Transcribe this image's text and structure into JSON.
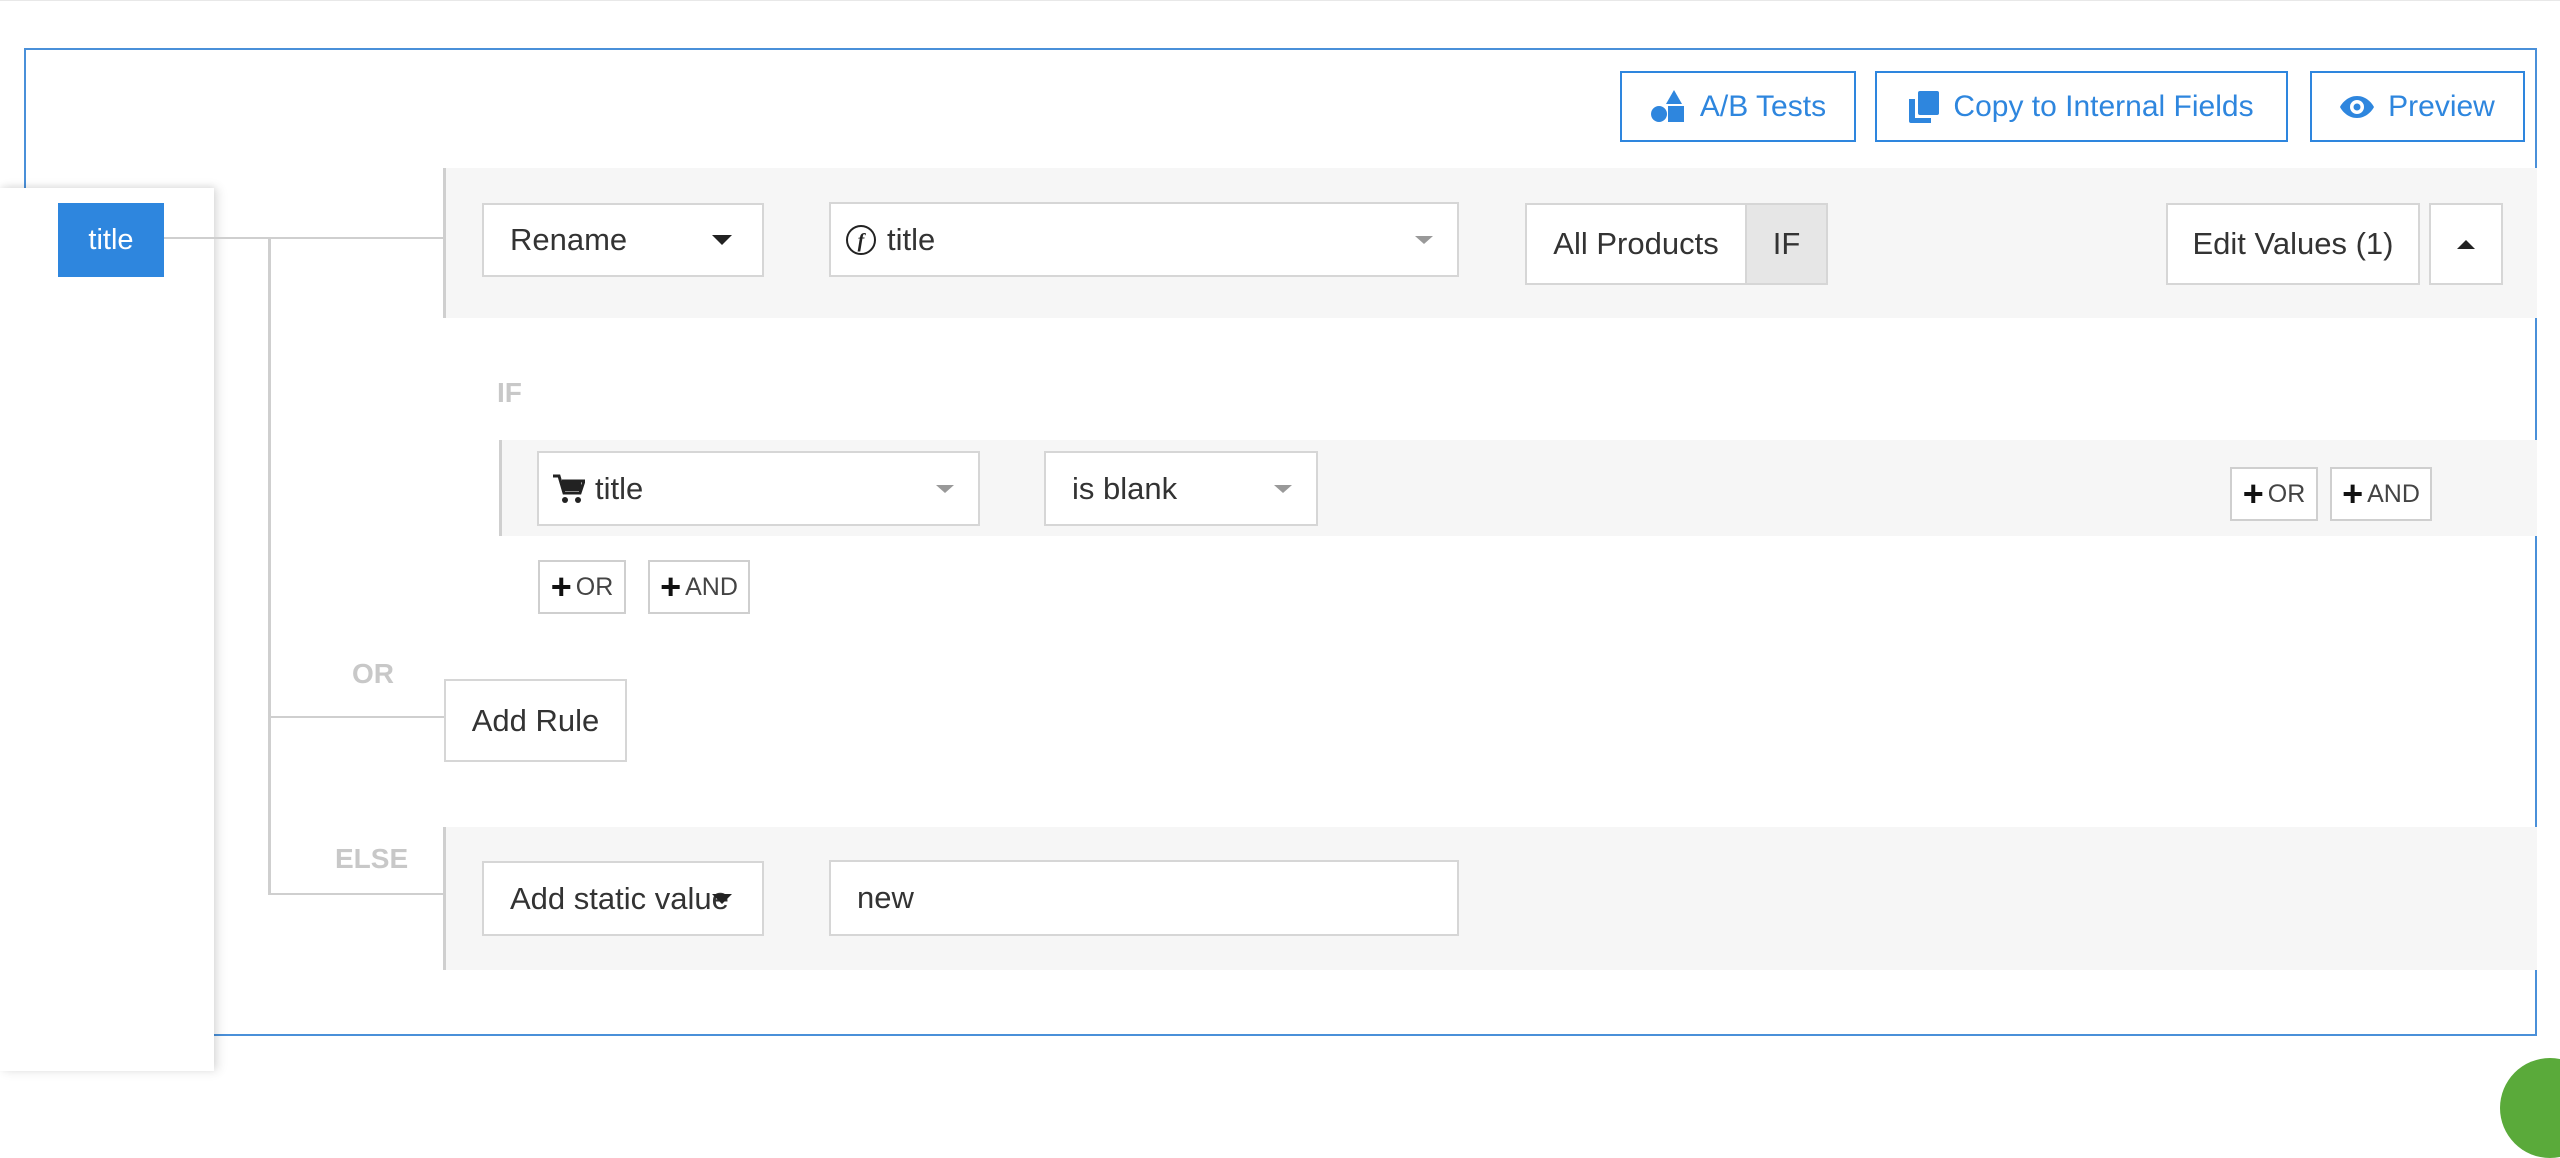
{
  "toolbar": {
    "ab_tests_label": "A/B Tests",
    "copy_label": "Copy to Internal Fields",
    "preview_label": "Preview"
  },
  "field": {
    "name": "title"
  },
  "rule": {
    "action": "Rename",
    "source_field": "title",
    "scope_label": "All Products",
    "if_toggle": "IF",
    "edit_values_label": "Edit Values (1)"
  },
  "condition": {
    "if_label": "IF",
    "field": "title",
    "operator": "is blank",
    "or_label": "OR",
    "and_label": "AND"
  },
  "or_section": {
    "label": "OR",
    "add_rule_label": "Add Rule"
  },
  "else_section": {
    "label": "ELSE",
    "action": "Add static value",
    "value": "new"
  },
  "colors": {
    "accent": "#2e86de",
    "border": "#4a90d9"
  }
}
